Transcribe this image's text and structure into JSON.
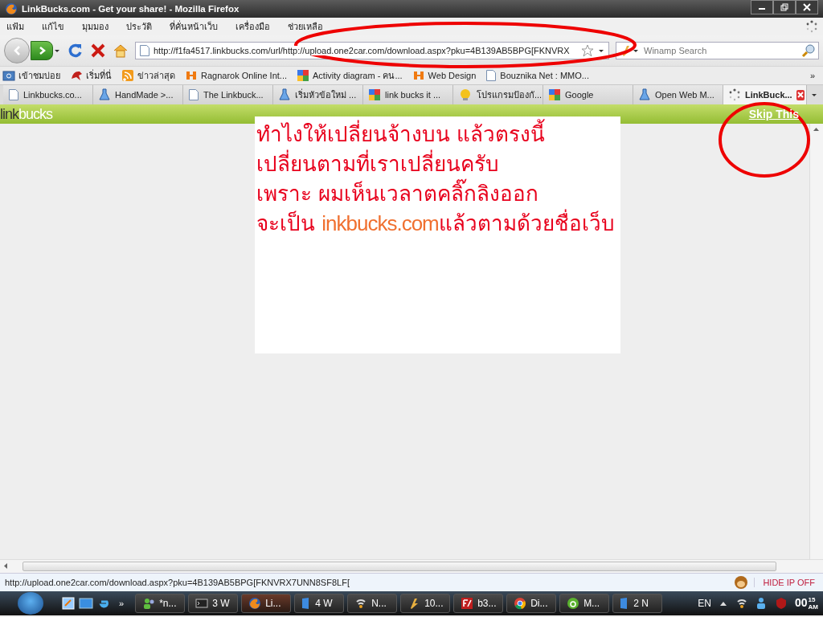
{
  "window": {
    "title": "LinkBucks.com - Get your share! - Mozilla Firefox"
  },
  "menu": [
    "แฟ้ม",
    "แก้ไข",
    "มุมมอง",
    "ประวัติ",
    "ที่คั่นหน้าเว็บ",
    "เครื่องมือ",
    "ช่วยเหลือ"
  ],
  "address": {
    "value": "http://f1fa4517.linkbucks.com/url/http://upload.one2car.com/download.aspx?pku=4B139AB5BPG[FKNVRX"
  },
  "search": {
    "placeholder": "Winamp Search"
  },
  "bookmarks": [
    {
      "label": "เข้าชมบ่อย",
      "kind": "folder"
    },
    {
      "label": "เริ่มที่นี่",
      "kind": "bird"
    },
    {
      "label": "ข่าวล่าสุด",
      "kind": "feed"
    },
    {
      "label": "Ragnarok Online Int...",
      "kind": "logo"
    },
    {
      "label": "Activity diagram - คน...",
      "kind": "google"
    },
    {
      "label": "Web Design",
      "kind": "logo"
    },
    {
      "label": "Bouznika Net : MMO...",
      "kind": "page"
    }
  ],
  "bookmarks_more": "»",
  "tabs": [
    {
      "label": "Linkbucks.co...",
      "kind": "page",
      "selected": false
    },
    {
      "label": "HandMade >...",
      "kind": "flask",
      "selected": false
    },
    {
      "label": "The Linkbuck...",
      "kind": "page",
      "selected": false
    },
    {
      "label": "เริ่มหัวข้อใหม่ ...",
      "kind": "flask",
      "selected": false
    },
    {
      "label": "link bucks it ...",
      "kind": "google",
      "selected": false
    },
    {
      "label": "โปรแกรมป้องกั...",
      "kind": "bulb",
      "selected": false
    },
    {
      "label": "Google",
      "kind": "google",
      "selected": false
    },
    {
      "label": "Open Web M...",
      "kind": "flask",
      "selected": false
    },
    {
      "label": "LinkBuck...",
      "kind": "loading",
      "selected": true
    }
  ],
  "banner": {
    "logo_first": "link",
    "logo_second": "bucks",
    "skip": "Skip This"
  },
  "note": {
    "lines": [
      {
        "parts": [
          {
            "text": "ทำไงให้เปลี่ยนจ้างบน แล้วตรงนี้",
            "kind": "plain"
          }
        ]
      },
      {
        "parts": [
          {
            "text": "เปลี่ยนตามที่เราเปลี่ยนครับ",
            "kind": "plain"
          }
        ]
      },
      {
        "parts": [
          {
            "text": "เพราะ ผมเห็นเวลาตคลิ๊กลิงออก",
            "kind": "plain"
          }
        ]
      },
      {
        "parts": [
          {
            "text": "จะเป็น ",
            "kind": "plain"
          },
          {
            "text": "inkbucks.com",
            "kind": "highlight"
          },
          {
            "text": "แล้วตามด้วยชื่อเว็บ",
            "kind": "plain"
          }
        ]
      }
    ]
  },
  "status_bar": {
    "url": "http://upload.one2car.com/download.aspx?pku=4B139AB5BPG[FKNVRX7UNN8SF8LF[",
    "hide_ip": "HIDE IP OFF"
  },
  "taskbar": {
    "buttons": [
      {
        "label": "*n...",
        "kind": "chat",
        "active": false
      },
      {
        "label": "3 W",
        "kind": "console",
        "active": false
      },
      {
        "label": "Li...",
        "kind": "firefox",
        "active": true
      },
      {
        "label": "4 W",
        "kind": "doc",
        "active": false
      },
      {
        "label": "N...",
        "kind": "net",
        "active": false
      },
      {
        "label": "10...",
        "kind": "winamp",
        "active": false
      },
      {
        "label": "b3...",
        "kind": "ftp",
        "active": false
      },
      {
        "label": "Di...",
        "kind": "chrome",
        "active": false
      },
      {
        "label": "M...",
        "kind": "dw",
        "active": false
      },
      {
        "label": "2 N",
        "kind": "doc",
        "active": false
      }
    ],
    "language": "EN",
    "clock_hour": "00",
    "clock_min": "15",
    "clock_ampm": "AM",
    "quick_more": "»"
  }
}
